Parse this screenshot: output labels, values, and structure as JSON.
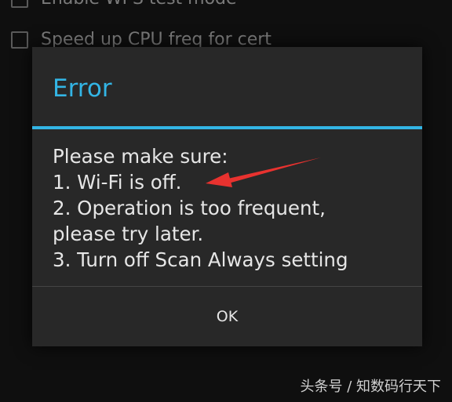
{
  "background": {
    "setting_wps": "Enable WPS test mode",
    "setting_cpu": "Speed up CPU freq for cert"
  },
  "dialog": {
    "title": "Error",
    "lines": [
      "Please make sure:",
      "1. Wi-Fi is off.",
      "2. Operation is too frequent,",
      "please try later.",
      "3. Turn off Scan Always setting"
    ],
    "ok_label": "OK"
  },
  "annotation": {
    "arrow_color": "#e8322f"
  },
  "watermark": "头条号 / 知数码行天下",
  "colors": {
    "accent": "#33b5e5",
    "dialog_bg": "#282828",
    "text": "#e6e6e6"
  }
}
